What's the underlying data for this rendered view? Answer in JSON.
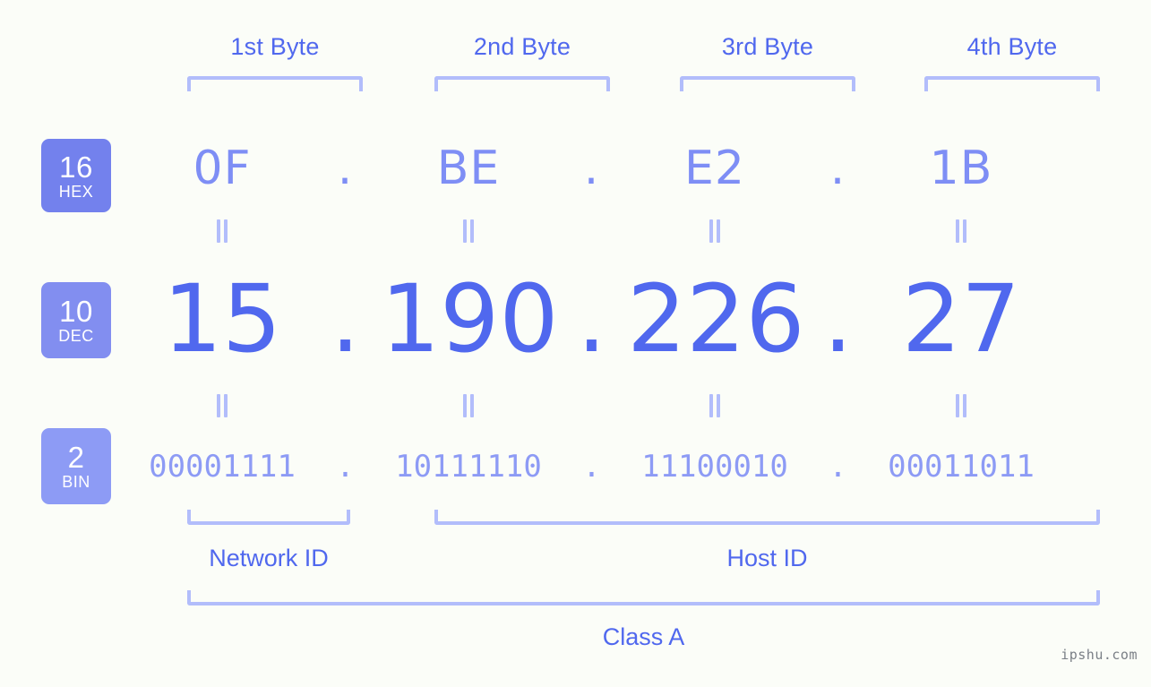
{
  "page": {
    "background": "#fbfdf8",
    "watermark": "ipshu.com"
  },
  "colors": {
    "bracket": "#b2bdfb",
    "hex_text": "#7e8ef5",
    "dec_text": "#5068ee",
    "bin_text": "#8d9bf5",
    "label_text": "#5068ee",
    "badge_hex": "#7381ed",
    "badge_dec": "#828ef0",
    "badge_bin": "#8d9bf5",
    "badge_text": "#ffffff",
    "watermark_text": "#7a7f86"
  },
  "byte_headers": [
    {
      "label": "1st Byte"
    },
    {
      "label": "2nd Byte"
    },
    {
      "label": "3rd Byte"
    },
    {
      "label": "4th Byte"
    }
  ],
  "bases": [
    {
      "id": "hex",
      "number": "16",
      "name": "HEX"
    },
    {
      "id": "dec",
      "number": "10",
      "name": "DEC"
    },
    {
      "id": "bin",
      "number": "2",
      "name": "BIN"
    }
  ],
  "separator": ".",
  "equals_glyph": "=",
  "rows": {
    "hex": {
      "base": "16",
      "values": [
        "0F",
        "BE",
        "E2",
        "1B"
      ]
    },
    "dec": {
      "base": "10",
      "values": [
        "15",
        "190",
        "226",
        "27"
      ]
    },
    "bin": {
      "base": "2",
      "values": [
        "00001111",
        "10111110",
        "11100010",
        "00011011"
      ]
    }
  },
  "ip": {
    "hex_address": "0F.BE.E2.1B",
    "dec_address": "15.190.226.27",
    "bin_address": "00001111.10111110.11100010.00011011"
  },
  "sections": {
    "network_id": "Network ID",
    "host_id": "Host ID",
    "class": "Class A"
  }
}
